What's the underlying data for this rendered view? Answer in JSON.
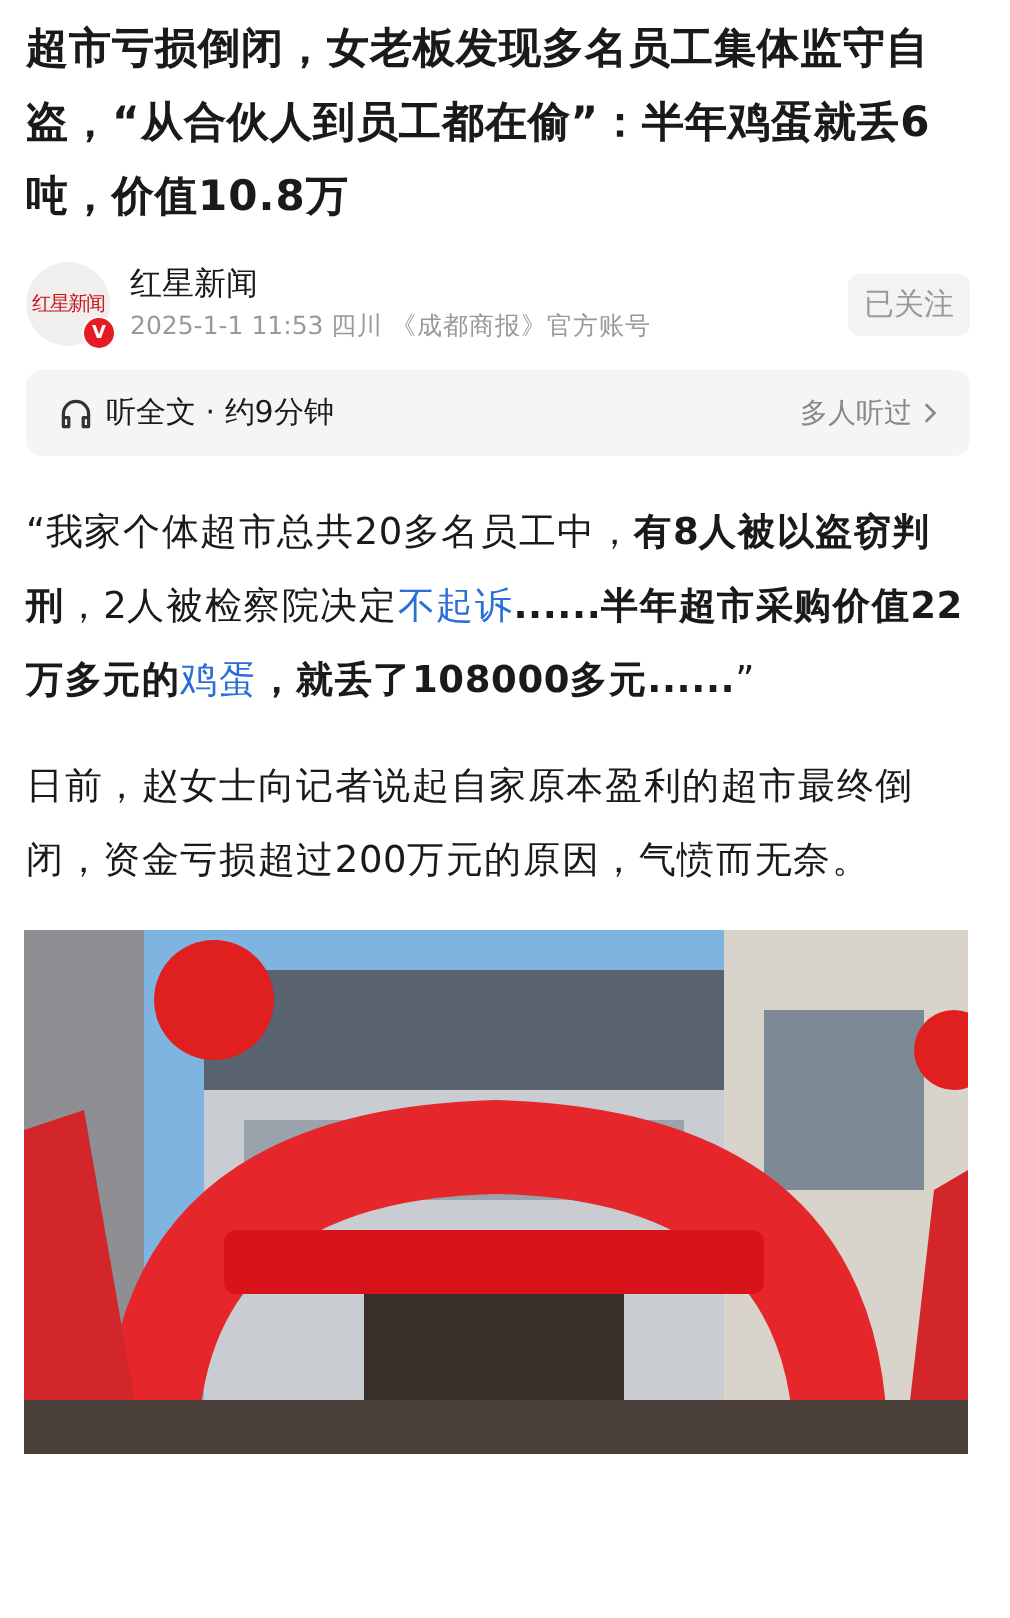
{
  "article": {
    "title": "超市亏损倒闭，女老板发现多名员工集体监守自盗，“从合伙人到员工都在偷”：半年鸡蛋就丢6吨，价值10.8万"
  },
  "author": {
    "logo_text": "红星新闻",
    "verified_mark": "V",
    "name": "红星新闻",
    "meta": "2025-1-1 11:53  四川  《成都商报》官方账号",
    "follow_button": "已关注"
  },
  "audio_bar": {
    "label": "听全文 · 约9分钟",
    "right_text": "多人听过"
  },
  "paragraphs": [
    {
      "segments": [
        {
          "kind": "text",
          "text": "“我家个体超市总共20多名员工中，"
        },
        {
          "kind": "bold",
          "text": "有8人被以盗窃判刑"
        },
        {
          "kind": "text",
          "text": "，2人被检察院决定"
        },
        {
          "kind": "link",
          "text": "不起诉"
        },
        {
          "kind": "bold",
          "text": "......半年超市采购价值22万多元的"
        },
        {
          "kind": "link",
          "text": "鸡蛋"
        },
        {
          "kind": "bold",
          "text": "，就丢了108000多元......"
        },
        {
          "kind": "text",
          "text": "”"
        }
      ]
    },
    {
      "segments": [
        {
          "kind": "text",
          "text": "日前，赵女士向记者说起自家原本盈利的超市最终倒闭，资金亏损超过200万元的原因，气愤而无奈。"
        }
      ]
    }
  ]
}
